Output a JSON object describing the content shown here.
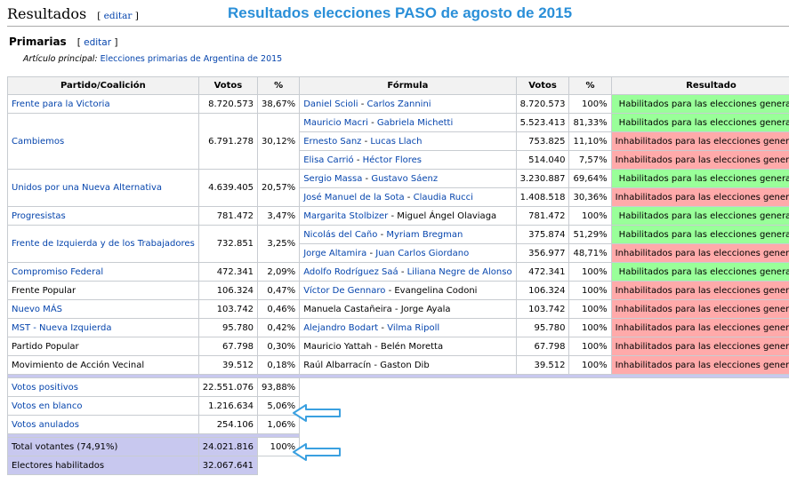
{
  "header": {
    "section_title": "Resultados",
    "edit_label": "editar",
    "page_title": "Resultados elecciones PASO de agosto de 2015"
  },
  "subsection": {
    "title": "Primarias",
    "edit_label": "editar",
    "main_article_prefix": "Artículo principal:",
    "main_article_link": "Elecciones primarias de Argentina de 2015"
  },
  "table": {
    "headers": [
      "Partido/Coalición",
      "Votos",
      "%",
      "Fórmula",
      "Votos",
      "%",
      "Resultado"
    ],
    "parties": [
      {
        "name": "Frente para la Victoria",
        "link": true,
        "votes": "8.720.573",
        "pct": "38,67%",
        "formulas": [
          {
            "p1": "Daniel Scioli",
            "p1_link": true,
            "p2": "Carlos Zannini",
            "p2_link": true,
            "votes": "8.720.573",
            "pct": "100%",
            "result": "Habilitados para las elecciones generales",
            "ok": true
          }
        ]
      },
      {
        "name": "Cambiemos",
        "link": true,
        "votes": "6.791.278",
        "pct": "30,12%",
        "formulas": [
          {
            "p1": "Mauricio Macri",
            "p1_link": true,
            "p2": "Gabriela Michetti",
            "p2_link": true,
            "votes": "5.523.413",
            "pct": "81,33%",
            "result": "Habilitados para las elecciones generales",
            "ok": true
          },
          {
            "p1": "Ernesto Sanz",
            "p1_link": true,
            "p2": "Lucas Llach",
            "p2_link": true,
            "votes": "753.825",
            "pct": "11,10%",
            "result": "Inhabilitados para las elecciones generales",
            "ok": false
          },
          {
            "p1": "Elisa Carrió",
            "p1_link": true,
            "p2": "Héctor Flores",
            "p2_link": true,
            "votes": "514.040",
            "pct": "7,57%",
            "result": "Inhabilitados para las elecciones generales",
            "ok": false
          }
        ]
      },
      {
        "name": "Unidos por una Nueva Alternativa",
        "link": true,
        "votes": "4.639.405",
        "pct": "20,57%",
        "formulas": [
          {
            "p1": "Sergio Massa",
            "p1_link": true,
            "p2": "Gustavo Sáenz",
            "p2_link": true,
            "votes": "3.230.887",
            "pct": "69,64%",
            "result": "Habilitados para las elecciones generales",
            "ok": true
          },
          {
            "p1": "José Manuel de la Sota",
            "p1_link": true,
            "p2": "Claudia Rucci",
            "p2_link": true,
            "votes": "1.408.518",
            "pct": "30,36%",
            "result": "Inhabilitados para las elecciones generales",
            "ok": false
          }
        ]
      },
      {
        "name": "Progresistas",
        "link": true,
        "votes": "781.472",
        "pct": "3,47%",
        "formulas": [
          {
            "p1": "Margarita Stolbizer",
            "p1_link": true,
            "p2": "Miguel Ángel Olaviaga",
            "p2_link": false,
            "votes": "781.472",
            "pct": "100%",
            "result": "Habilitados para las elecciones generales",
            "ok": true
          }
        ]
      },
      {
        "name": "Frente de Izquierda y de los Trabajadores",
        "link": true,
        "votes": "732.851",
        "pct": "3,25%",
        "formulas": [
          {
            "p1": "Nicolás del Caño",
            "p1_link": true,
            "p2": "Myriam Bregman",
            "p2_link": true,
            "votes": "375.874",
            "pct": "51,29%",
            "result": "Habilitados para las elecciones generales",
            "ok": true
          },
          {
            "p1": "Jorge Altamira",
            "p1_link": true,
            "p2": "Juan Carlos Giordano",
            "p2_link": true,
            "votes": "356.977",
            "pct": "48,71%",
            "result": "Inhabilitados para las elecciones generales",
            "ok": false
          }
        ]
      },
      {
        "name": "Compromiso Federal",
        "link": true,
        "votes": "472.341",
        "pct": "2,09%",
        "formulas": [
          {
            "p1": "Adolfo Rodríguez Saá",
            "p1_link": true,
            "p2": "Liliana Negre de Alonso",
            "p2_link": true,
            "votes": "472.341",
            "pct": "100%",
            "result": "Habilitados para las elecciones generales",
            "ok": true
          }
        ]
      },
      {
        "name": "Frente Popular",
        "link": false,
        "votes": "106.324",
        "pct": "0,47%",
        "formulas": [
          {
            "p1": "Víctor De Gennaro",
            "p1_link": true,
            "p2": "Evangelina Codoni",
            "p2_link": false,
            "votes": "106.324",
            "pct": "100%",
            "result": "Inhabilitados para las elecciones generales",
            "ok": false
          }
        ]
      },
      {
        "name": "Nuevo MÁS",
        "link": true,
        "votes": "103.742",
        "pct": "0,46%",
        "formulas": [
          {
            "p1": "Manuela Castañeira",
            "p1_link": false,
            "p2": "Jorge Ayala",
            "p2_link": false,
            "votes": "103.742",
            "pct": "100%",
            "result": "Inhabilitados para las elecciones generales",
            "ok": false
          }
        ]
      },
      {
        "name": "MST - Nueva Izquierda",
        "link": true,
        "votes": "95.780",
        "pct": "0,42%",
        "formulas": [
          {
            "p1": "Alejandro Bodart",
            "p1_link": true,
            "p2": "Vilma Ripoll",
            "p2_link": true,
            "votes": "95.780",
            "pct": "100%",
            "result": "Inhabilitados para las elecciones generales",
            "ok": false
          }
        ]
      },
      {
        "name": "Partido Popular",
        "link": false,
        "votes": "67.798",
        "pct": "0,30%",
        "formulas": [
          {
            "p1": "Mauricio Yattah",
            "p1_link": false,
            "p2": "Belén Moretta",
            "p2_link": false,
            "votes": "67.798",
            "pct": "100%",
            "result": "Inhabilitados para las elecciones generales",
            "ok": false
          }
        ]
      },
      {
        "name": "Movimiento de Acción Vecinal",
        "link": false,
        "votes": "39.512",
        "pct": "0,18%",
        "formulas": [
          {
            "p1": "Raúl Albarracín",
            "p1_link": false,
            "p2": "Gaston Dib",
            "p2_link": false,
            "votes": "39.512",
            "pct": "100%",
            "result": "Inhabilitados para las elecciones generales",
            "ok": false
          }
        ]
      }
    ],
    "summary": [
      {
        "label": "Votos positivos",
        "link": true,
        "votes": "22.551.076",
        "pct": "93,88%"
      },
      {
        "label": "Votos en blanco",
        "link": true,
        "votes": "1.216.634",
        "pct": "5,06%"
      },
      {
        "label": "Votos anulados",
        "link": true,
        "votes": "254.106",
        "pct": "1,06%"
      }
    ],
    "totals": [
      {
        "label": "Total votantes (74,91%)",
        "votes": "24.021.816",
        "pct": "100%"
      },
      {
        "label": "Electores habilitados",
        "votes": "32.067.641",
        "pct": ""
      }
    ]
  },
  "colors": {
    "link": "#0645ad",
    "title_blue": "#2a8fd8",
    "ok_bg": "#99ff99",
    "fail_bg": "#ffaaaa",
    "total_bg": "#c8c8ef",
    "arrow": "#3aa0e0"
  },
  "icons": [
    "arrow-left-icon"
  ]
}
